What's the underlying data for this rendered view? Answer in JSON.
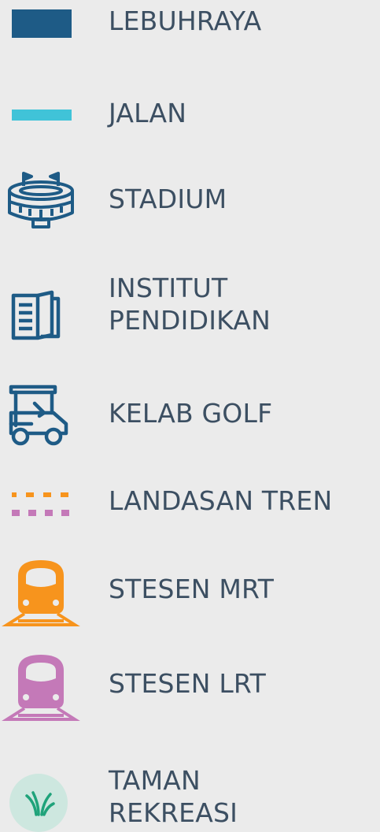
{
  "legend": {
    "items": [
      {
        "icon": "highway-line-icon",
        "label": "LEBUHRAYA",
        "color": "#1e5b86"
      },
      {
        "icon": "road-line-icon",
        "label": "JALAN",
        "color": "#40c3d8"
      },
      {
        "icon": "stadium-icon",
        "label": "STADIUM",
        "color": "#1e5b86"
      },
      {
        "icon": "book-icon",
        "lines": [
          "INSTITUT",
          "PENDIDIKAN"
        ],
        "color": "#1e5b86"
      },
      {
        "icon": "golf-cart-icon",
        "label": "KELAB GOLF",
        "color": "#1e5b86"
      },
      {
        "icon": "dashed-rail-line-icon",
        "label": "LANDASAN TREN",
        "colors": [
          "#f7941d",
          "#c479b8"
        ]
      },
      {
        "icon": "train-icon",
        "label": "STESEN MRT",
        "color": "#f7941d"
      },
      {
        "icon": "train-icon",
        "label": "STESEN LRT",
        "color": "#c479b8"
      },
      {
        "icon": "park-grass-icon",
        "lines": [
          "TAMAN",
          "REKREASI"
        ],
        "color": "#1fa37a",
        "background": "#cde7df"
      }
    ]
  }
}
